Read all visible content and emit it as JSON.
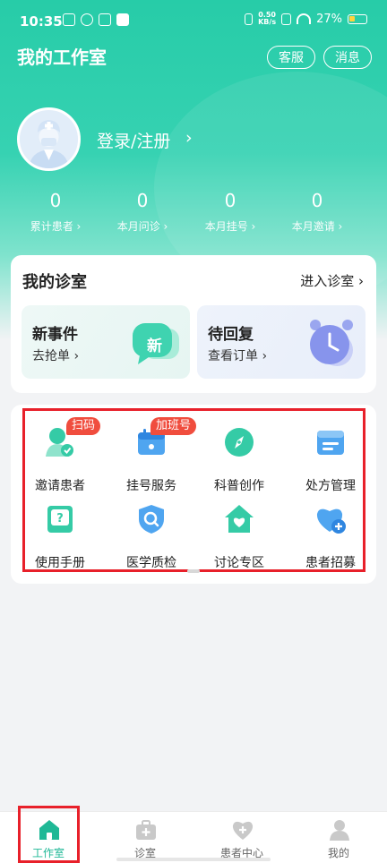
{
  "status_bar": {
    "time": "10:35",
    "net_speed_value": "0.50",
    "net_speed_unit": "KB/s",
    "battery": "27%"
  },
  "header": {
    "title": "我的工作室",
    "service_label": "客服",
    "message_label": "消息"
  },
  "profile": {
    "login_label": "登录/注册",
    "chevron": "›"
  },
  "stats": [
    {
      "value": "0",
      "label": "累计患者 ›"
    },
    {
      "value": "0",
      "label": "本月问诊 ›"
    },
    {
      "value": "0",
      "label": "本月挂号 ›"
    },
    {
      "value": "0",
      "label": "本月邀请 ›"
    }
  ],
  "clinic": {
    "title": "我的诊室",
    "enter_label": "进入诊室 ›",
    "tiles": [
      {
        "title": "新事件",
        "subtitle": "去抢单 ›",
        "art_text": "新"
      },
      {
        "title": "待回复",
        "subtitle": "查看订单 ›"
      }
    ]
  },
  "features": [
    {
      "label": "邀请患者",
      "icon": "invite-patient-icon",
      "badge": "扫码"
    },
    {
      "label": "挂号服务",
      "icon": "registration-icon",
      "badge": "加班号"
    },
    {
      "label": "科普创作",
      "icon": "compass-icon",
      "badge": ""
    },
    {
      "label": "处方管理",
      "icon": "prescription-icon",
      "badge": ""
    },
    {
      "label": "使用手册",
      "icon": "manual-icon",
      "badge": ""
    },
    {
      "label": "医学质检",
      "icon": "quality-check-icon",
      "badge": ""
    },
    {
      "label": "讨论专区",
      "icon": "discussion-icon",
      "badge": ""
    },
    {
      "label": "患者招募",
      "icon": "recruit-icon",
      "badge": ""
    }
  ],
  "tabs": [
    {
      "label": "工作室",
      "icon": "home-icon",
      "active": true
    },
    {
      "label": "诊室",
      "icon": "medical-kit-icon",
      "active": false
    },
    {
      "label": "患者中心",
      "icon": "heart-plus-icon",
      "active": false
    },
    {
      "label": "我的",
      "icon": "person-icon",
      "active": false
    }
  ],
  "colors": {
    "primary": "#27cca8",
    "badge": "#f04d3e",
    "highlight_box": "#e8202a",
    "active_tab": "#1fb896"
  }
}
